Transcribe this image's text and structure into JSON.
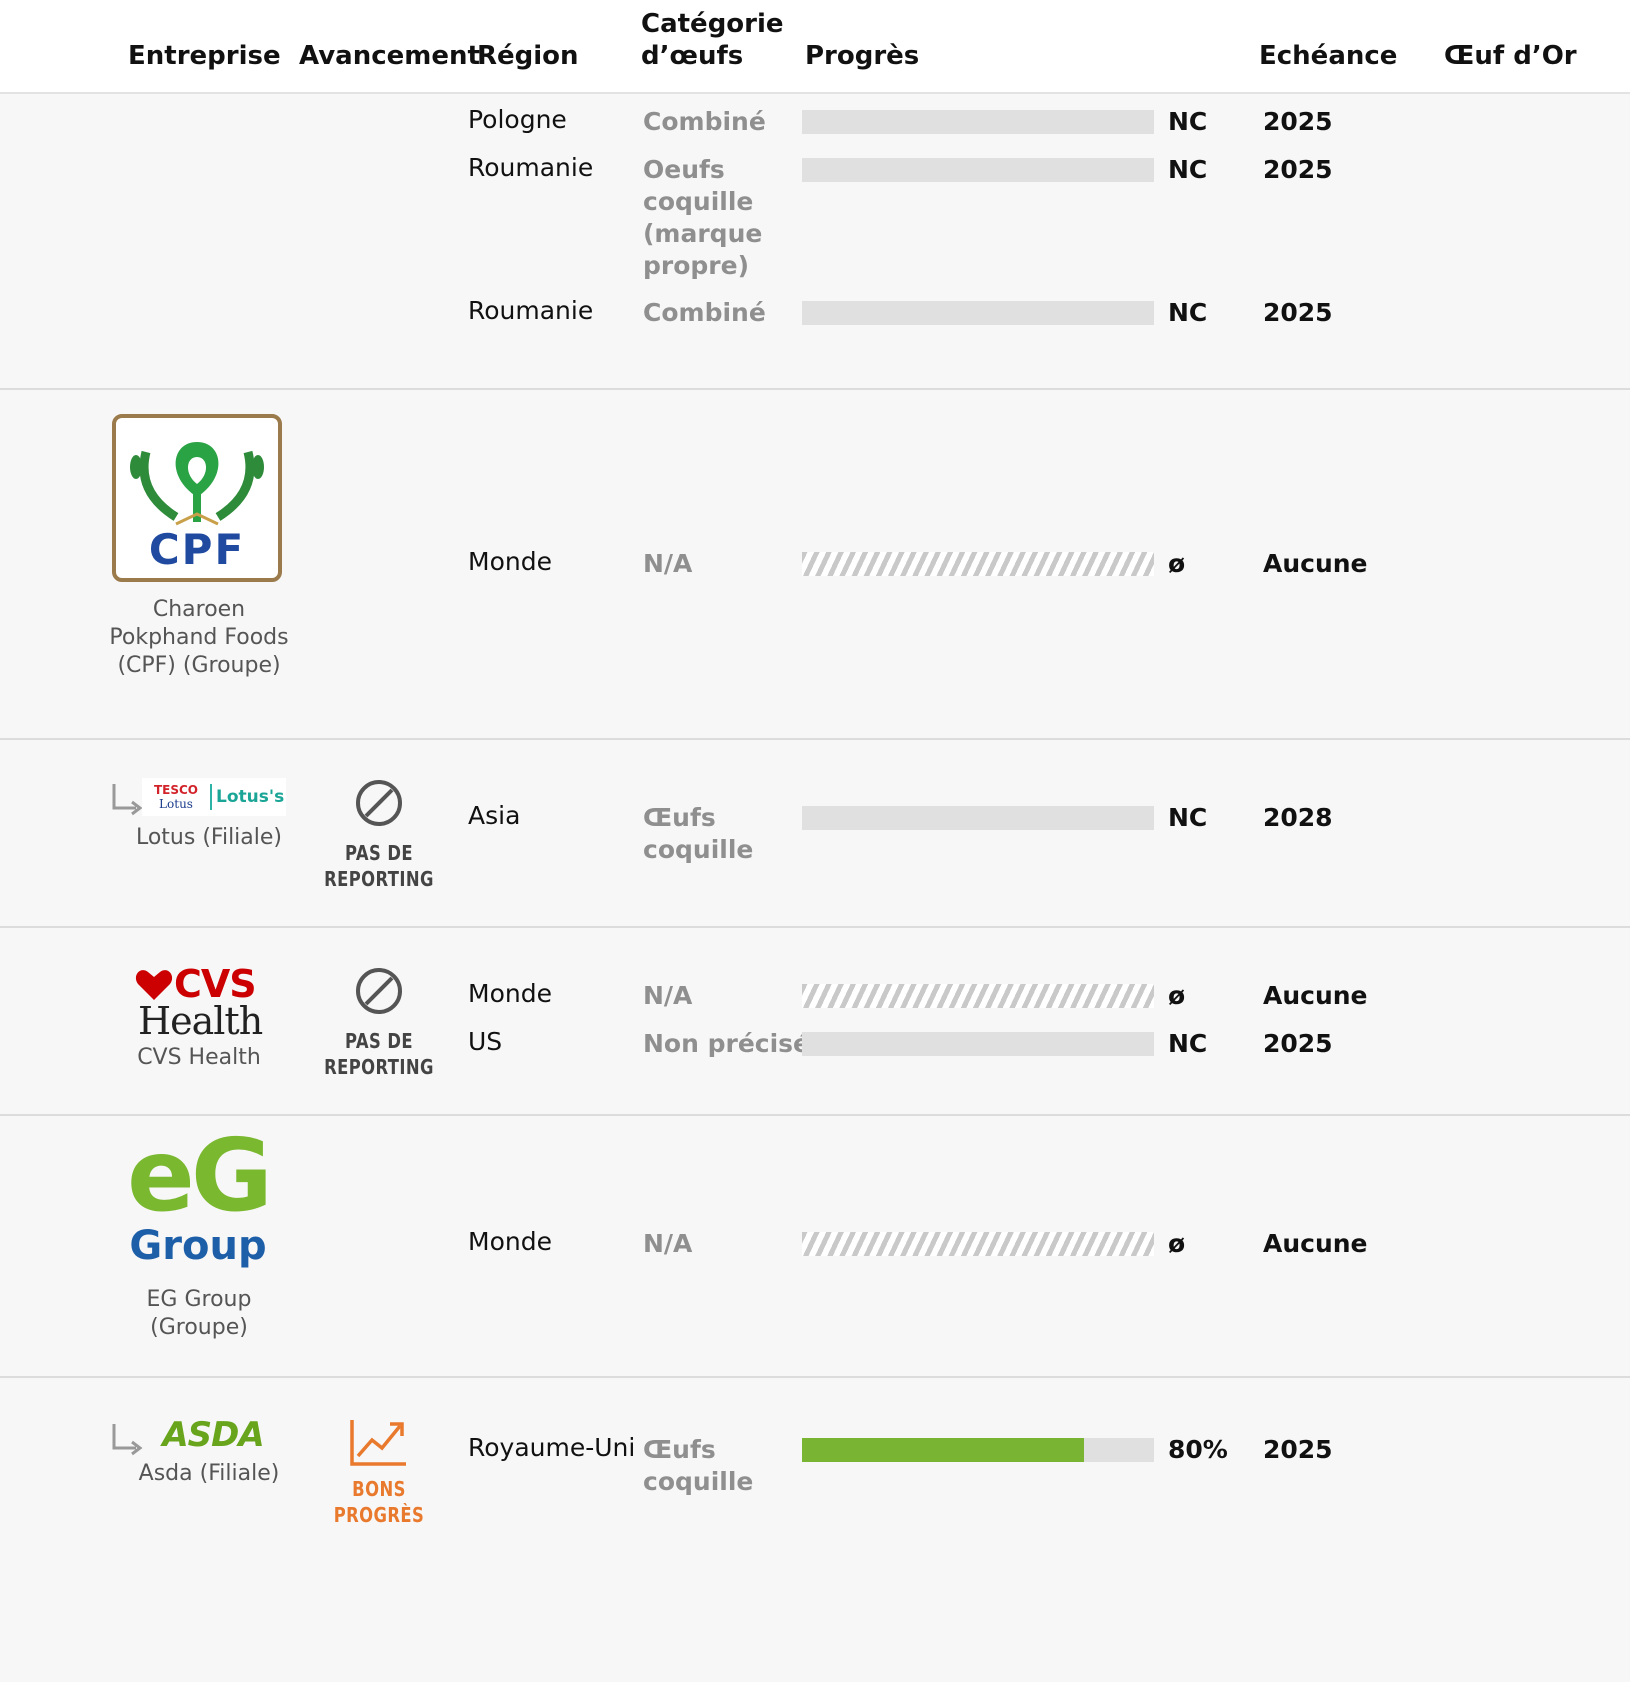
{
  "header": {
    "company": "Entreprise",
    "avancement": "Avancement",
    "region": "Région",
    "category": "Catégorie\nd’œufs",
    "category_line1": "Catégorie",
    "category_line2": "d’œufs",
    "progress": "Progrès",
    "deadline": "Echéance",
    "golden_egg": "Œuf d’Or"
  },
  "rows": [
    {
      "lines": [
        {
          "region": "Pologne",
          "category": "Combiné",
          "progress_pct": 0,
          "progress_label": "NC",
          "deadline": "2025"
        },
        {
          "region": "Roumanie",
          "category": "Oeufs coquille (marque propre)",
          "progress_pct": 0,
          "progress_label": "NC",
          "deadline": "2025"
        },
        {
          "region": "Roumanie",
          "category": "Combiné",
          "progress_pct": 0,
          "progress_label": "NC",
          "deadline": "2025"
        }
      ]
    },
    {
      "company_name": "Charoen Pokphand Foods (CPF) (Groupe)",
      "logo_text": "CPF",
      "lines": [
        {
          "region": "Monde",
          "category": "N/A",
          "progress_label": "ø",
          "deadline": "Aucune"
        }
      ]
    },
    {
      "company_name": "Lotus (Filiale)",
      "logo_text_1": "TESCO",
      "logo_text_2": "Lotus",
      "logo_text_3": "Lotus's",
      "status": "PAS DE REPORTING",
      "lines": [
        {
          "region": "Asia",
          "category": "Œufs coquille",
          "progress_pct": 0,
          "progress_label": "NC",
          "deadline": "2028"
        }
      ]
    },
    {
      "company_name": "CVS Health",
      "logo_text_1": "CVS",
      "logo_text_2": "Health",
      "status": "PAS DE REPORTING",
      "lines": [
        {
          "region": "Monde",
          "category": "N/A",
          "progress_label": "ø",
          "deadline": "Aucune"
        },
        {
          "region": "US",
          "category": "Non précisé",
          "progress_pct": 0,
          "progress_label": "NC",
          "deadline": "2025"
        }
      ]
    },
    {
      "company_name": "EG Group (Groupe)",
      "logo_text_1": "eG",
      "logo_text_2": "Group",
      "lines": [
        {
          "region": "Monde",
          "category": "N/A",
          "progress_label": "ø",
          "deadline": "Aucune"
        }
      ]
    },
    {
      "company_name": "Asda (Filiale)",
      "logo_text": "ASDA",
      "status": "BONS PROGRÈS",
      "lines": [
        {
          "region": "Royaume-Uni",
          "category": "Œufs coquille",
          "progress_pct": 80,
          "progress_label": "80%",
          "deadline": "2025"
        }
      ]
    }
  ],
  "colors": {
    "progress_fill": "#79b532",
    "progress_empty": "#e0e0e0",
    "good_progress": "#e8792d",
    "no_reporting": "#444444",
    "cpf_green": "#2aa345",
    "cpf_blue": "#1f4aa0",
    "cvs_red": "#cc0000",
    "eg_green": "#7ab82f",
    "eg_blue": "#1d5ea8",
    "asda_green": "#68a51c"
  }
}
